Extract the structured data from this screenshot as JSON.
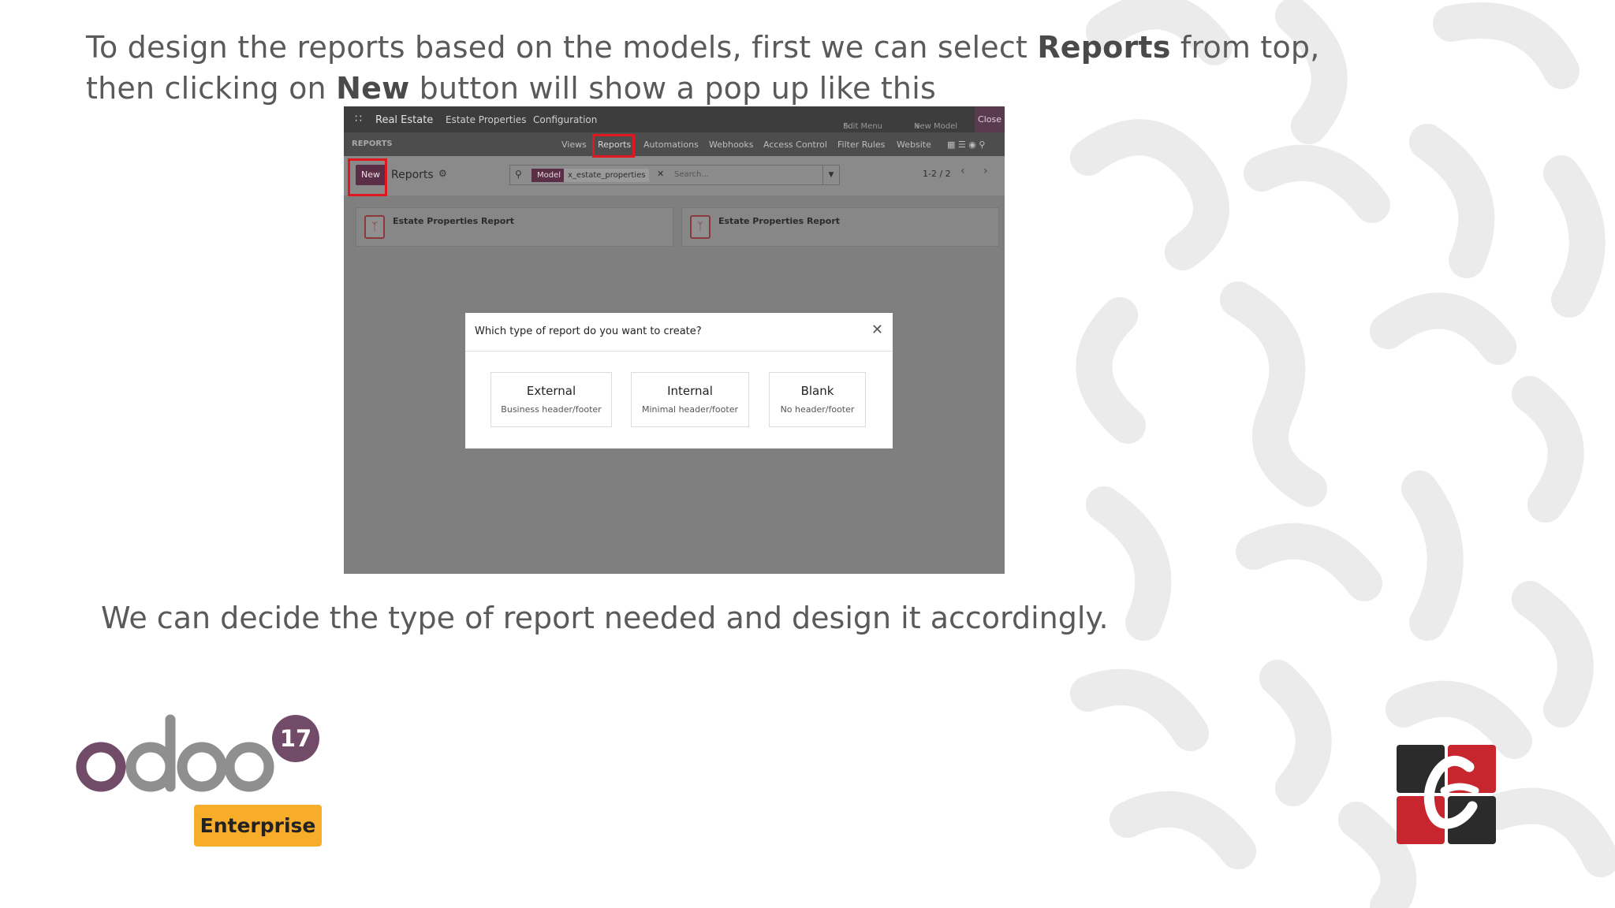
{
  "slide": {
    "intro_line1_a": "To design the reports based on the models, first we can select ",
    "intro_line1_b": "Reports",
    "intro_line1_c": " from top,",
    "intro_line2_a": "then clicking on ",
    "intro_line2_b": "New",
    "intro_line2_c": " button will show a pop up like this",
    "outro": "We can decide the type of report needed and design it accordingly."
  },
  "app": {
    "topbar": {
      "app_name": "Real Estate",
      "menu": [
        "Estate Properties",
        "Configuration"
      ],
      "edit_menu": "Edit Menu",
      "new_model": "New Model",
      "close": "Close"
    },
    "studio_bar": {
      "section": "REPORTS",
      "tabs": [
        "Views",
        "Reports",
        "Automations",
        "Webhooks",
        "Access Control",
        "Filter Rules",
        "Website"
      ]
    },
    "control_panel": {
      "new_button": "New",
      "title": "Reports",
      "search_facet_key": "Model",
      "search_facet_value": "x_estate_properties",
      "search_placeholder": "Search...",
      "pager": "1-2 / 2"
    },
    "cards": [
      "Estate Properties Report",
      "Estate Properties Report"
    ],
    "dialog": {
      "title": "Which type of report do you want to create?",
      "options": [
        {
          "title": "External",
          "subtitle": "Business header/footer"
        },
        {
          "title": "Internal",
          "subtitle": "Minimal header/footer"
        },
        {
          "title": "Blank",
          "subtitle": "No header/footer"
        }
      ]
    }
  },
  "logos": {
    "version_badge": "17",
    "edition_badge": "Enterprise",
    "odoo_wordmark": "odoo",
    "brand_colors": {
      "odoo_purple": "#714b67",
      "odoo_grey": "#8f8f8f",
      "enterprise_orange": "#f8ad2a",
      "redbox": "#e0171e"
    }
  }
}
